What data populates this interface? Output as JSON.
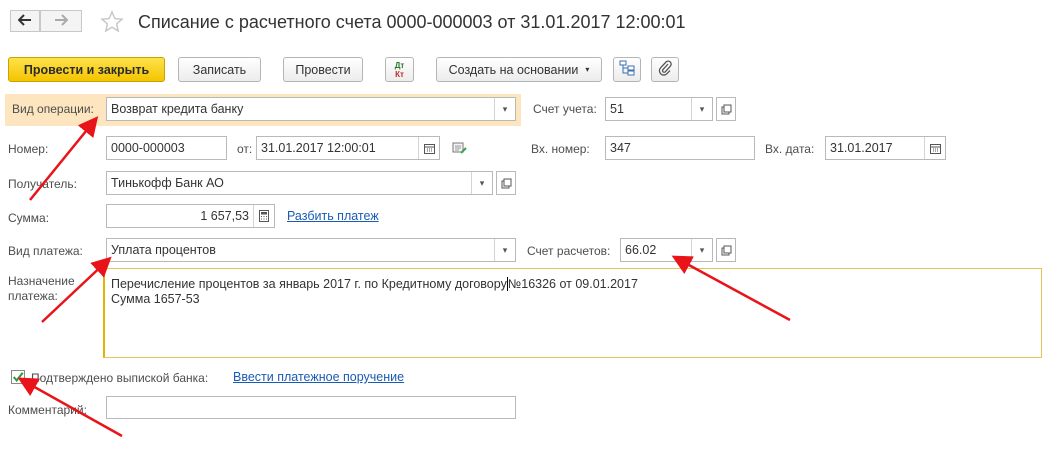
{
  "window": {
    "title": "Списание с расчетного счета 0000-000003 от 31.01.2017 12:00:01"
  },
  "toolbar": {
    "post_close_label": "Провести и закрыть",
    "save_label": "Записать",
    "post_label": "Провести",
    "dtkt_top": "Дт",
    "dtkt_bottom": "Кт",
    "create_based_label": "Создать на основании"
  },
  "form": {
    "operation_type": {
      "label": "Вид операции:",
      "value": "Возврат кредита банку"
    },
    "account": {
      "label": "Счет учета:",
      "value": "51"
    },
    "number": {
      "label": "Номер:",
      "value": "0000-000003"
    },
    "from": {
      "label": "от:",
      "value": "31.01.2017 12:00:01"
    },
    "incoming_number": {
      "label": "Вх. номер:",
      "value": "347"
    },
    "incoming_date": {
      "label": "Вх. дата:",
      "value": "31.01.2017"
    },
    "recipient": {
      "label": "Получатель:",
      "value": "Тинькофф Банк АО"
    },
    "amount": {
      "label": "Сумма:",
      "value": "1 657,53",
      "split_link": "Разбить платеж"
    },
    "payment_type": {
      "label": "Вид платежа:",
      "value": "Уплата процентов"
    },
    "settlement_account": {
      "label": "Счет расчетов:",
      "value": "66.02"
    },
    "purpose": {
      "label_line1": "Назначение",
      "label_line2": "платежа:",
      "line1": "Перечисление процентов за январь 2017 г. по Кредитному договору",
      "line2": "№16326 от 09.01.2017",
      "line3": "Сумма 1657-53"
    },
    "confirmed": {
      "label": "Подтверждено выпиской банка:",
      "checked": true,
      "link": "Ввести платежное поручение"
    },
    "comment": {
      "label": "Комментарий:",
      "value": ""
    }
  },
  "colors": {
    "primary_button": "#f5c400",
    "highlight": "#fce5bf",
    "link": "#1a5bb4",
    "annotation_arrow": "#e8141a",
    "checkmark": "#2e9b3c"
  }
}
